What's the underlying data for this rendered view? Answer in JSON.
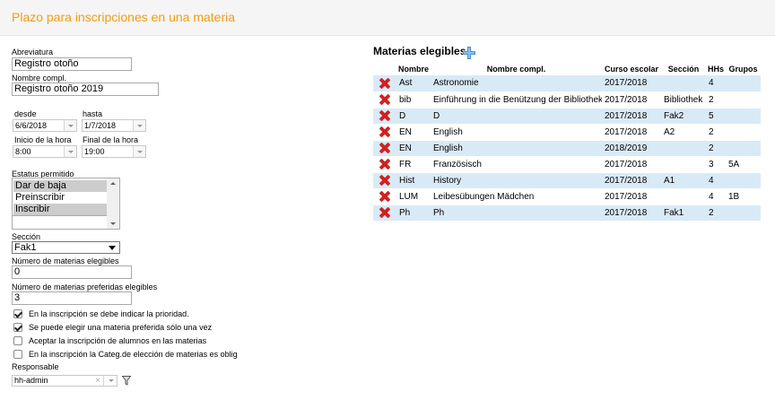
{
  "header": {
    "title": "Plazo para inscripciones en una materia"
  },
  "form": {
    "abreviatura": {
      "label": "Abreviatura",
      "value": "Registro otoño"
    },
    "nombre": {
      "label": "Nombre compl.",
      "value": "Registro otoño 2019"
    },
    "desde": {
      "label": "desde",
      "value": "6/6/2018"
    },
    "hasta": {
      "label": "hasta",
      "value": "1/7/2018"
    },
    "inicio": {
      "label": "Inicio de la hora",
      "value": "8:00"
    },
    "final": {
      "label": "Final de la hora",
      "value": "19:00"
    },
    "estatus": {
      "label": "Estatus permitido",
      "options": [
        {
          "label": "Dar de baja",
          "selected": true
        },
        {
          "label": "Preinscribir",
          "selected": false
        },
        {
          "label": "Inscribir",
          "selected": true
        }
      ]
    },
    "seccion": {
      "label": "Sección",
      "value": "Fak1"
    },
    "num_materias": {
      "label": "Número de materias elegibles",
      "value": "0"
    },
    "num_preferidas": {
      "label": "Número de materias preferidas elegibles",
      "value": "3"
    },
    "checkboxes": [
      {
        "label": "En la inscripción se debe indicar la prioridad.",
        "checked": true
      },
      {
        "label": "Se puede elegir una materia preferida sólo una vez",
        "checked": true
      },
      {
        "label": "Aceptar la inscripción de alumnos en las materias",
        "checked": false
      },
      {
        "label": "En la inscripción la Categ.de elección de materias es oblig",
        "checked": false
      }
    ],
    "responsable": {
      "label": "Responsable",
      "value": "hh-admin",
      "clear_icon": "×"
    }
  },
  "materias": {
    "title": "Materias elegibles",
    "add_icon": "plus-icon",
    "delete_icon": "delete-x-icon",
    "accent": "#d32020",
    "row_stripe": "#d9eaf7",
    "columns": [
      "Nombre",
      "Nombre compl.",
      "Curso escolar",
      "Sección",
      "HHs",
      "Grupos"
    ],
    "rows": [
      {
        "nombre": "Ast",
        "completo": "Astronomie",
        "curso": "2017/2018",
        "seccion": "",
        "hhs": "4",
        "grupos": ""
      },
      {
        "nombre": "bib",
        "completo": "Einführung in die Benützung der Bibliothek",
        "curso": "2017/2018",
        "seccion": "Bibliothek",
        "hhs": "2",
        "grupos": ""
      },
      {
        "nombre": "D",
        "completo": "D",
        "curso": "2017/2018",
        "seccion": "Fak2",
        "hhs": "5",
        "grupos": ""
      },
      {
        "nombre": "EN",
        "completo": "English",
        "curso": "2017/2018",
        "seccion": "A2",
        "hhs": "2",
        "grupos": ""
      },
      {
        "nombre": "EN",
        "completo": "English",
        "curso": "2018/2019",
        "seccion": "",
        "hhs": "2",
        "grupos": ""
      },
      {
        "nombre": "FR",
        "completo": "Französisch",
        "curso": "2017/2018",
        "seccion": "",
        "hhs": "3",
        "grupos": "5A"
      },
      {
        "nombre": "Hist",
        "completo": "History",
        "curso": "2017/2018",
        "seccion": "A1",
        "hhs": "4",
        "grupos": ""
      },
      {
        "nombre": "LUM",
        "completo": "Leibesübungen Mädchen",
        "curso": "2017/2018",
        "seccion": "",
        "hhs": "4",
        "grupos": "1B"
      },
      {
        "nombre": "Ph",
        "completo": "Ph",
        "curso": "2017/2018",
        "seccion": "Fak1",
        "hhs": "2",
        "grupos": ""
      }
    ]
  }
}
